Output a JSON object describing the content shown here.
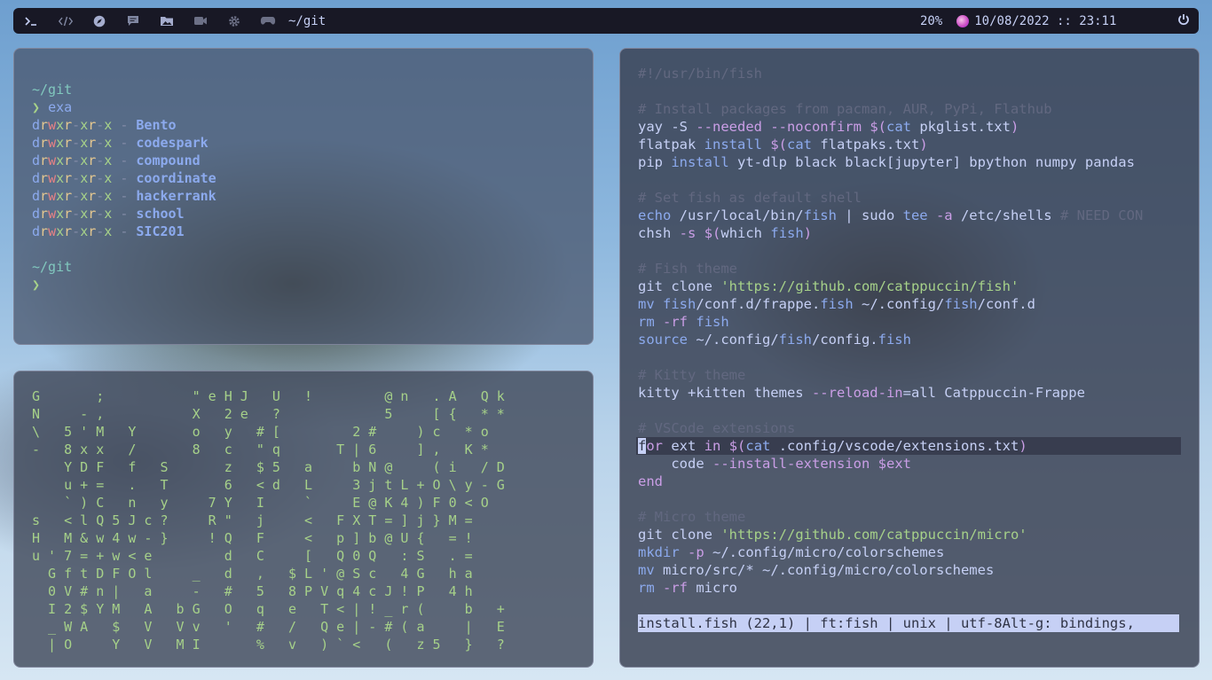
{
  "topbar": {
    "icons": [
      "terminal-icon",
      "code-icon",
      "compass-icon",
      "chat-icon",
      "folder-images-icon",
      "video-icon",
      "gear-icon",
      "gamepad-icon"
    ],
    "path": "~/git",
    "battery": "20%",
    "date": "10/08/2022",
    "separator": "::",
    "time": "23:11",
    "power_icon": "power-icon"
  },
  "terminal": {
    "prompt_dir": "~/git",
    "command": "exa",
    "entries": [
      {
        "perms": [
          "d",
          "r",
          "w",
          "x",
          "r",
          "-",
          "x",
          "r",
          "-",
          "x"
        ],
        "size": "-",
        "name": "Bento"
      },
      {
        "perms": [
          "d",
          "r",
          "w",
          "x",
          "r",
          "-",
          "x",
          "r",
          "-",
          "x"
        ],
        "size": "-",
        "name": "codespark"
      },
      {
        "perms": [
          "d",
          "r",
          "w",
          "x",
          "r",
          "-",
          "x",
          "r",
          "-",
          "x"
        ],
        "size": "-",
        "name": "compound"
      },
      {
        "perms": [
          "d",
          "r",
          "w",
          "x",
          "r",
          "-",
          "x",
          "r",
          "-",
          "x"
        ],
        "size": "-",
        "name": "coordinate"
      },
      {
        "perms": [
          "d",
          "r",
          "w",
          "x",
          "r",
          "-",
          "x",
          "r",
          "-",
          "x"
        ],
        "size": "-",
        "name": "hackerrank"
      },
      {
        "perms": [
          "d",
          "r",
          "w",
          "x",
          "r",
          "-",
          "x",
          "r",
          "-",
          "x"
        ],
        "size": "-",
        "name": "school"
      },
      {
        "perms": [
          "d",
          "r",
          "w",
          "x",
          "r",
          "-",
          "x",
          "r",
          "-",
          "x"
        ],
        "size": "-",
        "name": "SIC201"
      }
    ],
    "prompt_dir_2": "~/git"
  },
  "matrix": {
    "rows": [
      "G       ;           \" e H J   U   !         @ n   . A   Q k",
      "N     - ,           X   2 e   ?             5     [ {   * *",
      "\\   5 ' M   Y       o   y   # [         2 #     ) c   * o",
      "-   8 x x   /       8   c   \" q       T | 6     ] ,   K *",
      "    Y D F   f   S       z   $ 5   a     b N @     ( i   / D",
      "    u + =   .   T       6   < d   L     3 j t L + O \\ y - G",
      "    ` ) C   n   y     7 Y   I     `     E @ K 4 ) F 0 < O",
      "s   < l Q 5 J c ?     R \"   j     <   F X T = ] j } M =",
      "H   M & w 4 w - }     ! Q   F     <   p ] b @ U {   = !",
      "u ' 7 = + w < e         d   C     [   Q 0 Q   : S   . =",
      "  G f t D F O l     _   d   ,   $ L ' @ S c   4 G   h a",
      "  0 V # n |   a     -   #   5   8 P V q 4 c J ! P   4 h",
      "  I 2 $ Y M   A   b G   O   q   e   T < | ! _ r (     b   +",
      "  _ W A   $   V   V v   '   #   /   Q e | - # ( a     |   E",
      "  | O     Y   V   M I       %   v   ) ` <   (   z 5   }   ?"
    ]
  },
  "editor": {
    "lines": [
      [
        {
          "t": "#!/usr/bin/fish",
          "c": "com"
        }
      ],
      [],
      [
        {
          "t": "# Install packages from pacman, AUR, PyPi, Flathub",
          "c": "com"
        }
      ],
      [
        {
          "t": "yay -S ",
          "c": ""
        },
        {
          "t": "--needed --noconfirm",
          "c": "flag"
        },
        {
          "t": " ",
          "c": ""
        },
        {
          "t": "$(",
          "c": "sub"
        },
        {
          "t": "cat",
          "c": "fn"
        },
        {
          "t": " pkglist.txt",
          "c": ""
        },
        {
          "t": ")",
          "c": "sub"
        }
      ],
      [
        {
          "t": "flatpak ",
          "c": ""
        },
        {
          "t": "install",
          "c": "fn"
        },
        {
          "t": " ",
          "c": ""
        },
        {
          "t": "$(",
          "c": "sub"
        },
        {
          "t": "cat",
          "c": "fn"
        },
        {
          "t": " flatpaks.txt",
          "c": ""
        },
        {
          "t": ")",
          "c": "sub"
        }
      ],
      [
        {
          "t": "pip ",
          "c": ""
        },
        {
          "t": "install",
          "c": "fn"
        },
        {
          "t": " yt-dlp black black[jupyter] bpython numpy pandas",
          "c": ""
        }
      ],
      [],
      [
        {
          "t": "# Set fish as default shell",
          "c": "com"
        }
      ],
      [
        {
          "t": "echo",
          "c": "fn"
        },
        {
          "t": " /usr/local/bin/",
          "c": ""
        },
        {
          "t": "fish",
          "c": "fn"
        },
        {
          "t": " | sudo ",
          "c": ""
        },
        {
          "t": "tee",
          "c": "fn"
        },
        {
          "t": " ",
          "c": ""
        },
        {
          "t": "-a",
          "c": "flag"
        },
        {
          "t": " /etc/shells ",
          "c": ""
        },
        {
          "t": "# NEED CON",
          "c": "com"
        }
      ],
      [
        {
          "t": "chsh ",
          "c": ""
        },
        {
          "t": "-s",
          "c": "flag"
        },
        {
          "t": " ",
          "c": ""
        },
        {
          "t": "$(",
          "c": "sub"
        },
        {
          "t": "which ",
          "c": ""
        },
        {
          "t": "fish",
          "c": "fn"
        },
        {
          "t": ")",
          "c": "sub"
        }
      ],
      [],
      [
        {
          "t": "# Fish theme",
          "c": "com"
        }
      ],
      [
        {
          "t": "git clone ",
          "c": ""
        },
        {
          "t": "'https://github.com/catppuccin/fish'",
          "c": "str"
        }
      ],
      [
        {
          "t": "mv",
          "c": "fn"
        },
        {
          "t": " ",
          "c": ""
        },
        {
          "t": "fish",
          "c": "fn"
        },
        {
          "t": "/conf.d/frappe.",
          "c": ""
        },
        {
          "t": "fish",
          "c": "fn"
        },
        {
          "t": " ~/.config/",
          "c": ""
        },
        {
          "t": "fish",
          "c": "fn"
        },
        {
          "t": "/conf.d",
          "c": ""
        }
      ],
      [
        {
          "t": "rm",
          "c": "fn"
        },
        {
          "t": " ",
          "c": ""
        },
        {
          "t": "-rf",
          "c": "flag"
        },
        {
          "t": " ",
          "c": ""
        },
        {
          "t": "fish",
          "c": "fn"
        }
      ],
      [
        {
          "t": "source",
          "c": "fn"
        },
        {
          "t": " ~/.config/",
          "c": ""
        },
        {
          "t": "fish",
          "c": "fn"
        },
        {
          "t": "/config.",
          "c": ""
        },
        {
          "t": "fish",
          "c": "fn"
        }
      ],
      [],
      [
        {
          "t": "# Kitty theme",
          "c": "com"
        }
      ],
      [
        {
          "t": "kitty +kitten themes ",
          "c": ""
        },
        {
          "t": "--reload-in",
          "c": "flag"
        },
        {
          "t": "=all Catppuccin-Frappe",
          "c": ""
        }
      ],
      [],
      [
        {
          "t": "# VSCode extensions",
          "c": "com"
        }
      ],
      [
        {
          "t": "f",
          "c": "cursor"
        },
        {
          "t": "or",
          "c": "kw"
        },
        {
          "t": " ext ",
          "c": ""
        },
        {
          "t": "in",
          "c": "kw"
        },
        {
          "t": " ",
          "c": ""
        },
        {
          "t": "$(",
          "c": "sub"
        },
        {
          "t": "cat",
          "c": "fn"
        },
        {
          "t": " .config/vscode/extensions.txt",
          "c": ""
        },
        {
          "t": ")",
          "c": "sub"
        }
      ],
      [
        {
          "t": "    code ",
          "c": ""
        },
        {
          "t": "--install-extension",
          "c": "flag"
        },
        {
          "t": " ",
          "c": ""
        },
        {
          "t": "$ext",
          "c": "var"
        }
      ],
      [
        {
          "t": "end",
          "c": "kw"
        }
      ],
      [],
      [
        {
          "t": "# Micro theme",
          "c": "com"
        }
      ],
      [
        {
          "t": "git clone ",
          "c": ""
        },
        {
          "t": "'https://github.com/catppuccin/micro'",
          "c": "str"
        }
      ],
      [
        {
          "t": "mkdir",
          "c": "fn"
        },
        {
          "t": " ",
          "c": ""
        },
        {
          "t": "-p",
          "c": "flag"
        },
        {
          "t": " ~/.config/micro/colorschemes",
          "c": ""
        }
      ],
      [
        {
          "t": "mv",
          "c": "fn"
        },
        {
          "t": " micro/src/* ~/.config/micro/colorschemes",
          "c": ""
        }
      ],
      [
        {
          "t": "rm",
          "c": "fn"
        },
        {
          "t": " ",
          "c": ""
        },
        {
          "t": "-rf",
          "c": "flag"
        },
        {
          "t": " micro",
          "c": ""
        }
      ]
    ],
    "current_line_index": 21,
    "status": "install.fish (22,1) | ft:fish | unix | utf-8Alt-g: bindings,"
  }
}
